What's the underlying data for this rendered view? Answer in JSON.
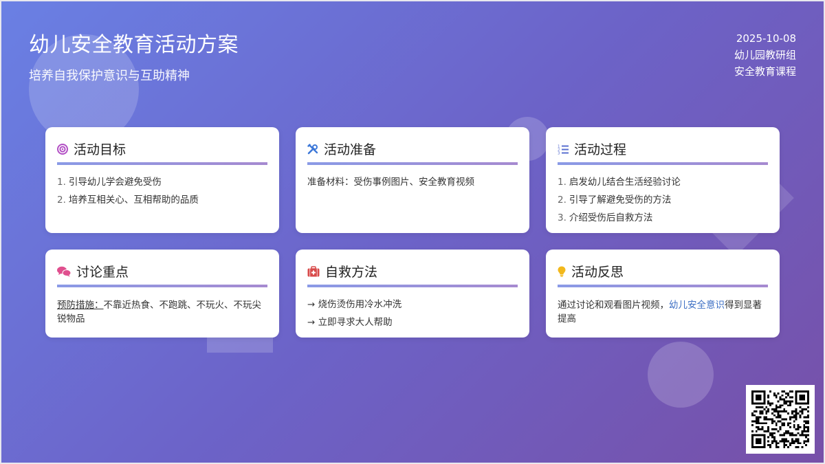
{
  "header": {
    "title": "幼儿安全教育活动方案",
    "subtitle": "培养自我保护意识与互助精神",
    "date": "2025-10-08",
    "org": "幼儿园教研组",
    "course": "安全教育课程"
  },
  "cards": {
    "goals": {
      "icon": "target-icon",
      "title": "活动目标",
      "items": [
        {
          "num": "1.",
          "text": "引导幼儿学会避免受伤"
        },
        {
          "num": "2.",
          "text": "培养互相关心、互相帮助的品质"
        }
      ]
    },
    "prep": {
      "icon": "tools-icon",
      "title": "活动准备",
      "text": "准备材料：受伤事例图片、安全教育视频"
    },
    "process": {
      "icon": "list-ordered-icon",
      "title": "活动过程",
      "items": [
        {
          "num": "1.",
          "text": "启发幼儿结合生活经验讨论"
        },
        {
          "num": "2.",
          "text": "引导了解避免受伤的方法"
        },
        {
          "num": "3.",
          "text": "介绍受伤后自救方法"
        }
      ]
    },
    "discussion": {
      "icon": "chat-bubbles-icon",
      "title": "讨论重点",
      "label": "预防措施：",
      "text": "不靠近热食、不跑跳、不玩火、不玩尖锐物品"
    },
    "selfrescue": {
      "icon": "first-aid-kit-icon",
      "title": "自救方法",
      "items": [
        {
          "arrow": "→",
          "text": "烧伤烫伤用冷水冲洗"
        },
        {
          "arrow": "→",
          "text": "立即寻求大人帮助"
        }
      ]
    },
    "reflection": {
      "icon": "lightbulb-icon",
      "title": "活动反思",
      "text_before": "通过讨论和观看图片视频，",
      "highlight": "幼儿安全意识",
      "text_after": "得到显著提高"
    }
  },
  "colors": {
    "accent": "#3d6fc4",
    "target": "#b24fc4",
    "tools": "#3d78d8",
    "list": "#5a6fd0",
    "chat": "#e04f8e",
    "firstaid": "#d84a4a",
    "bulb": "#f2b81c"
  },
  "qr_icon": "qr-code-icon"
}
